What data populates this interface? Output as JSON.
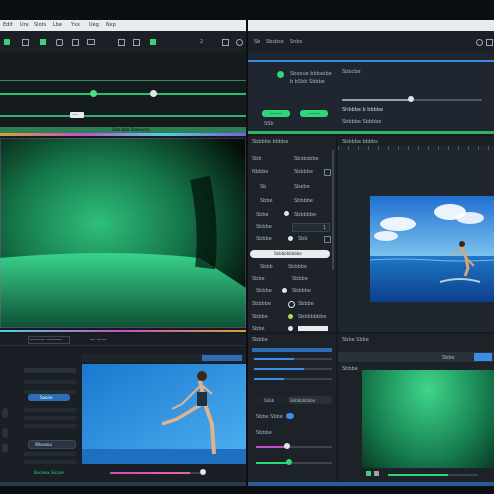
{
  "left": {
    "menu": [
      "Edit",
      "Ure",
      "Slots",
      "Lbe",
      "Yxx",
      "Ueg",
      "Nxp"
    ],
    "toolbar_readout": "2",
    "marker_label": "----",
    "track_caption": "Sele bbe Sbeeuery",
    "bottom": {
      "tab_a": "——— ———",
      "tab_b": "— ——",
      "active_item": "Saone",
      "selected_item": "Wlosoou",
      "footer_label": "Bocieex Siscae",
      "figure_alt": "dancer-photo"
    }
  },
  "right": {
    "top_toolbar": [
      "Sb",
      "Sbsbso",
      "Snbs"
    ],
    "settings_card": {
      "title": "Sbooue bbbasbe",
      "subtitle": "b bSbb Sbbbe",
      "btn_a": "———",
      "btn_b": "———",
      "small": "SSb",
      "header_right": "Sbbcbe",
      "label_right": "Shbbbe b bbbbe",
      "caption_right": "Sbbbbe Sbbbbe"
    },
    "props": {
      "header": "Sbbbbe bbbbe",
      "tab_right": "Sbbbbe bbbbs",
      "rows": [
        {
          "label": "Sbb",
          "value": "Sbobsbbe"
        },
        {
          "label": "Nbbbe",
          "value": "Sbbbbe"
        },
        {
          "label": "Sb",
          "value": "Sbebe"
        },
        {
          "label": "Sbbe",
          "value": "Sbbbbe"
        },
        {
          "label": "Sbbe",
          "value": "Sbbbbbe"
        },
        {
          "label": "Sbbbe",
          "value": "1"
        },
        {
          "label": "Sbbbe",
          "value": "Sbb"
        }
      ],
      "button": "Sbbbbbbbbbe",
      "rows2": [
        {
          "label": "Sbbb",
          "value": "Sbbbbe"
        },
        {
          "label": "Sbbe",
          "value": "Sbbbe"
        },
        {
          "label": "Sbbbe",
          "value": "Sbbbbe"
        },
        {
          "label": "Sbbbbe",
          "value": "Sbbbe"
        },
        {
          "label": "Sbbbe",
          "value": "Sbbbbbbbe"
        },
        {
          "label": "Sbbe",
          "value": "Sbbbbe"
        }
      ]
    },
    "preview_alt": "surfer-photo",
    "bottom": {
      "header_left": "Sbbbe",
      "header_right": "Sbbe Sbbe",
      "tab_a": "Sbbb",
      "tab_b": "Sbbbbbbbbe",
      "toggle_label": "Sbbe Sbbe",
      "row_label": "Sbbbe",
      "right_tab": "Sbbe",
      "right_label": "Sbbbe"
    }
  },
  "colors": {
    "accent_green": "#2fd67a",
    "accent_blue": "#3a8ee6",
    "panel": "#1c2228",
    "bg": "#0b0e12"
  }
}
